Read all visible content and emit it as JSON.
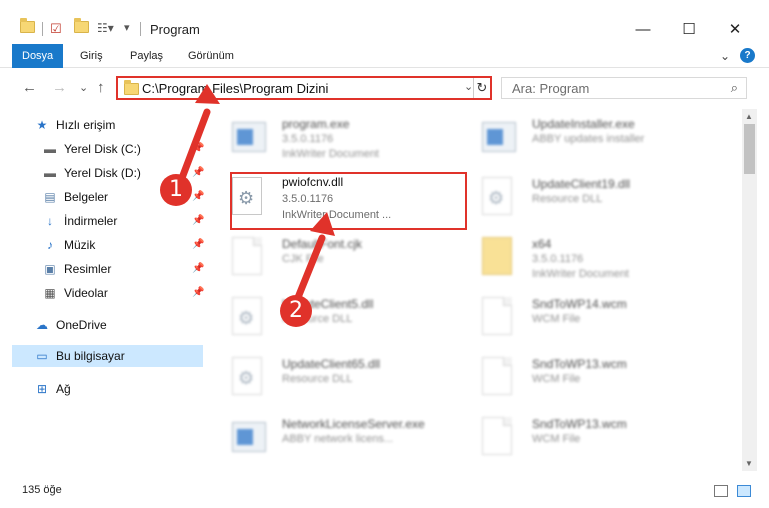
{
  "window": {
    "title": "Program",
    "minimize": "—",
    "maximize": "☐",
    "close": "✕"
  },
  "ribbon": {
    "tabs": [
      "Dosya",
      "Giriş",
      "Paylaş",
      "Görünüm"
    ],
    "expand": "⌄",
    "help": "?"
  },
  "nav": {
    "back": "←",
    "forward": "→",
    "recent": "⌄",
    "up": "↑"
  },
  "address": {
    "path": "C:\\Program Files\\Program Dizini",
    "dropdown": "⌄",
    "refresh": "↻"
  },
  "search": {
    "placeholder": "Ara: Program",
    "icon": "⌕"
  },
  "sidebar": {
    "items": [
      {
        "label": "Hızlı erişim",
        "icon": "★"
      },
      {
        "label": "Yerel Disk (C:)",
        "icon": "▬"
      },
      {
        "label": "Yerel Disk (D:)",
        "icon": "▬"
      },
      {
        "label": "Belgeler",
        "icon": "▤"
      },
      {
        "label": "İndirmeler",
        "icon": "↓"
      },
      {
        "label": "Müzik",
        "icon": "♪"
      },
      {
        "label": "Resimler",
        "icon": "▣"
      },
      {
        "label": "Videolar",
        "icon": "▦"
      },
      {
        "label": "OneDrive",
        "icon": "☁"
      },
      {
        "label": "Bu bilgisayar",
        "icon": "▭"
      },
      {
        "label": "Ağ",
        "icon": "⊞"
      }
    ]
  },
  "files": [
    {
      "name": "program.exe",
      "line2": "3.5.0.1176",
      "line3": "InkWriter Document"
    },
    {
      "name": "UpdateInstaller.exe",
      "line2": "ABBY updates installer",
      "line3": ""
    },
    {
      "name": "pwiofcnv.dll",
      "line2": "3.5.0.1176",
      "line3": "InkWriter Document ..."
    },
    {
      "name": "UpdateClient19.dll",
      "line2": "Resource DLL",
      "line3": ""
    },
    {
      "name": "DefaultFont.cjk",
      "line2": "CJK File",
      "line3": ""
    },
    {
      "name": "x64",
      "line2": "3.5.0.1176",
      "line3": "InkWriter Document"
    },
    {
      "name": "UpdateClient5.dll",
      "line2": "Resource DLL",
      "line3": ""
    },
    {
      "name": "SndToWP14.wcm",
      "line2": "WCM File",
      "line3": ""
    },
    {
      "name": "UpdateClient65.dll",
      "line2": "Resource DLL",
      "line3": ""
    },
    {
      "name": "SndToWP13.wcm",
      "line2": "WCM File",
      "line3": ""
    },
    {
      "name": "NetworkLicenseServer.exe",
      "line2": "ABBY network licens...",
      "line3": ""
    },
    {
      "name": "SndToWP13.wcm",
      "line2": "WCM File",
      "line3": ""
    }
  ],
  "annotations": {
    "marker1": "1",
    "marker2": "2"
  },
  "status": {
    "count": "135 öğe"
  }
}
